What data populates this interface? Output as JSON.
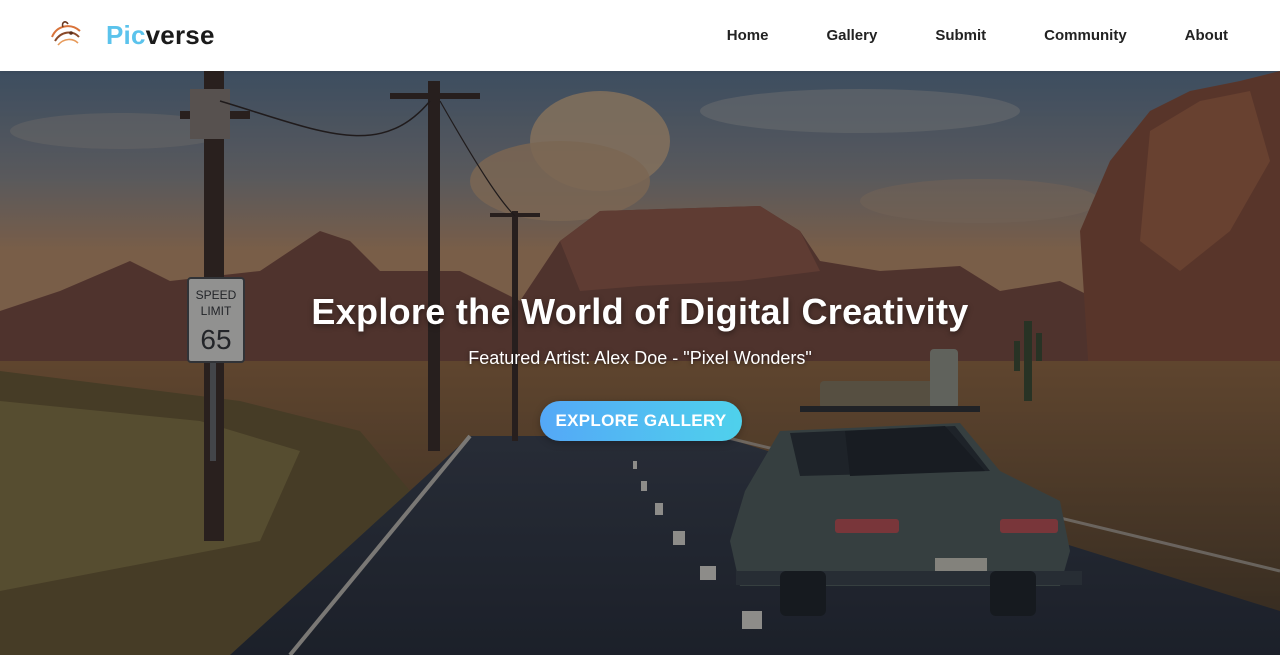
{
  "header": {
    "brand_part1": "Pic",
    "brand_part2": "verse",
    "logo_icon": "stylized-bird-logo",
    "nav": [
      {
        "label": "Home"
      },
      {
        "label": "Gallery"
      },
      {
        "label": "Submit"
      },
      {
        "label": "Community"
      },
      {
        "label": "About"
      }
    ]
  },
  "hero": {
    "title": "Explore the World of Digital Creativity",
    "subtitle": "Featured Artist: Alex Doe - \"Pixel Wonders\"",
    "cta_label": "EXPLORE GALLERY",
    "sign_top": "SPEED",
    "sign_mid": "LIMIT",
    "sign_number": "65"
  },
  "colors": {
    "brand_accent": "#5bc3ec",
    "brand_dark": "#1b1b1b",
    "cta_gradient_start": "#54a8f7",
    "cta_gradient_end": "#4fd1ec"
  }
}
